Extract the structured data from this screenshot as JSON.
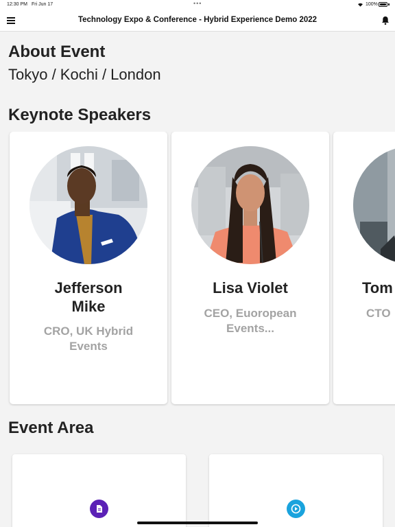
{
  "status_bar": {
    "time": "12:30 PM",
    "date": "Fri Jun 17",
    "battery": "100%"
  },
  "app_bar": {
    "title": "Technology Expo & Conference - Hybrid Experience Demo 2022",
    "menu_icon": "hamburger-menu-icon",
    "bell_icon": "bell-icon"
  },
  "about": {
    "title": "About Event",
    "locations": "Tokyo / Kochi / London"
  },
  "keynote": {
    "title": "Keynote Speakers",
    "speakers": [
      {
        "name": "Jefferson Mike",
        "role": "CRO, UK Hybrid Events"
      },
      {
        "name": "Lisa Violet",
        "role": "CEO, Euoropean Events..."
      },
      {
        "name": "Tom",
        "role": "CTO"
      }
    ]
  },
  "event_area": {
    "title": "Event Area",
    "cards": [
      {
        "icon": "document-icon",
        "color": "#5b21b6"
      },
      {
        "icon": "play-icon",
        "color": "#1aa3dd"
      }
    ]
  },
  "colors": {
    "background": "#f3f3f3",
    "card": "#ffffff",
    "role_text": "#a3a3a3"
  }
}
